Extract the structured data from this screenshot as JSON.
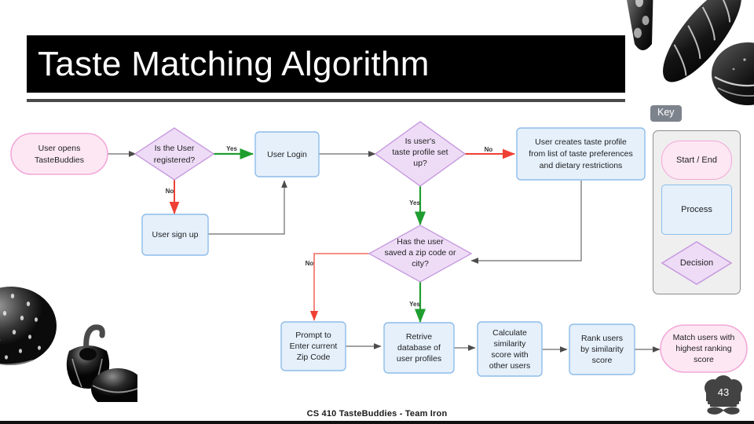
{
  "slide": {
    "title": "Taste Matching Algorithm",
    "footer": "CS 410 TasteBuddies - Team Iron",
    "page_number": "43"
  },
  "theme": {
    "title_bar_bg": "#000000",
    "title_text": "#ffffff",
    "start_end_fill": "#fce7f3",
    "start_end_stroke": "#f3a8d8",
    "process_fill": "#e5f0fb",
    "process_stroke": "#8ebcea",
    "decision_fill": "#eedcf7",
    "decision_stroke": "#c79cde",
    "edge_default": "#6b6b6b",
    "edge_yes": "#1f9e2f",
    "edge_no": "#ef4035",
    "key_panel_bg": "#efefef",
    "key_badge_bg": "#7d838c"
  },
  "flowchart": {
    "nodes": {
      "start": {
        "lines": [
          "User opens",
          "TasteBuddies"
        ],
        "type": "start-end"
      },
      "is_registered": {
        "lines": [
          "Is the User",
          "registered?"
        ],
        "type": "decision"
      },
      "user_sign_up": {
        "lines": [
          "User sign up"
        ],
        "type": "process"
      },
      "user_login": {
        "lines": [
          "User Login"
        ],
        "type": "process"
      },
      "taste_profile_set": {
        "lines": [
          "Is user's",
          "taste profile set",
          "up?"
        ],
        "type": "decision"
      },
      "create_taste_profile": {
        "lines": [
          "User creates taste profile",
          "from list of taste preferences",
          "and dietary restrictions"
        ],
        "type": "process"
      },
      "has_zip": {
        "lines": [
          "Has the user",
          "saved  a zip code or",
          "city?"
        ],
        "type": "decision"
      },
      "prompt_zip": {
        "lines": [
          "Prompt to",
          "Enter current",
          "Zip Code"
        ],
        "type": "process"
      },
      "retrieve_db": {
        "lines": [
          "Retrive",
          "database of",
          "user profiles"
        ],
        "type": "process"
      },
      "calculate_similarity": {
        "lines": [
          "Calculate",
          "similarity",
          "score with",
          "other users"
        ],
        "type": "process"
      },
      "rank_users": {
        "lines": [
          "Rank users",
          "by similarity",
          "score"
        ],
        "type": "process"
      },
      "match_users": {
        "lines": [
          "Match users with",
          "highest ranking",
          "score"
        ],
        "type": "start-end"
      }
    },
    "edge_labels": {
      "registered_yes": "Yes",
      "registered_no": "No",
      "profile_no": "No",
      "profile_yes": "Yes",
      "zip_no": "No",
      "zip_yes": "Yes"
    }
  },
  "key": {
    "badge_label": "Key",
    "items": [
      {
        "label": "Start / End",
        "shape": "rounded-pill"
      },
      {
        "label": "Process",
        "shape": "rectangle"
      },
      {
        "label": "Decision",
        "shape": "diamond"
      }
    ]
  }
}
